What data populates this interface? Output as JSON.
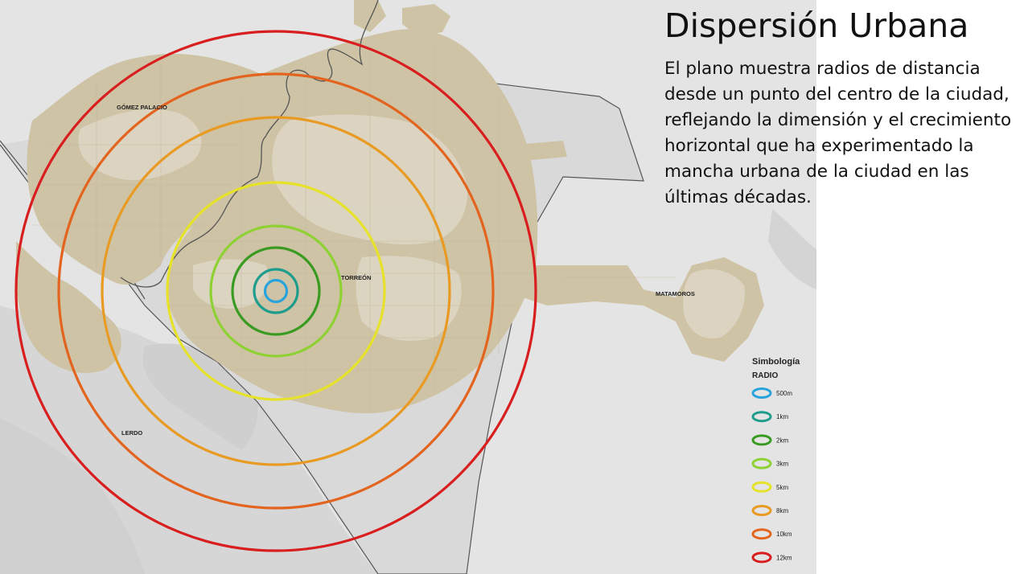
{
  "title": "Dispersión Urbana",
  "description_lines": [
    "El plano muestra radios de distancia",
    "desde un punto del centro de la ciudad,",
    "reflejando la dimensión y el crecimiento",
    "horizontal que ha experimentado la",
    "mancha urbana de la ciudad en las",
    "últimas décadas."
  ],
  "places": {
    "gomez_palacio": "GÓMEZ PALACIO",
    "torreon": "TORREÓN",
    "lerdo": "LERDO",
    "matamoros": "MATAMOROS"
  },
  "legend": {
    "title": "Simbología",
    "subtitle": "RADIO",
    "items": [
      {
        "label": "500m",
        "color": "#29a3dc"
      },
      {
        "label": "1km",
        "color": "#1e9c8c"
      },
      {
        "label": "2km",
        "color": "#3a9b22"
      },
      {
        "label": "3km",
        "color": "#8ed132"
      },
      {
        "label": "5km",
        "color": "#e6e22a"
      },
      {
        "label": "8km",
        "color": "#e89a23"
      },
      {
        "label": "10km",
        "color": "#e2641e"
      },
      {
        "label": "12km",
        "color": "#d81e1e"
      }
    ]
  }
}
